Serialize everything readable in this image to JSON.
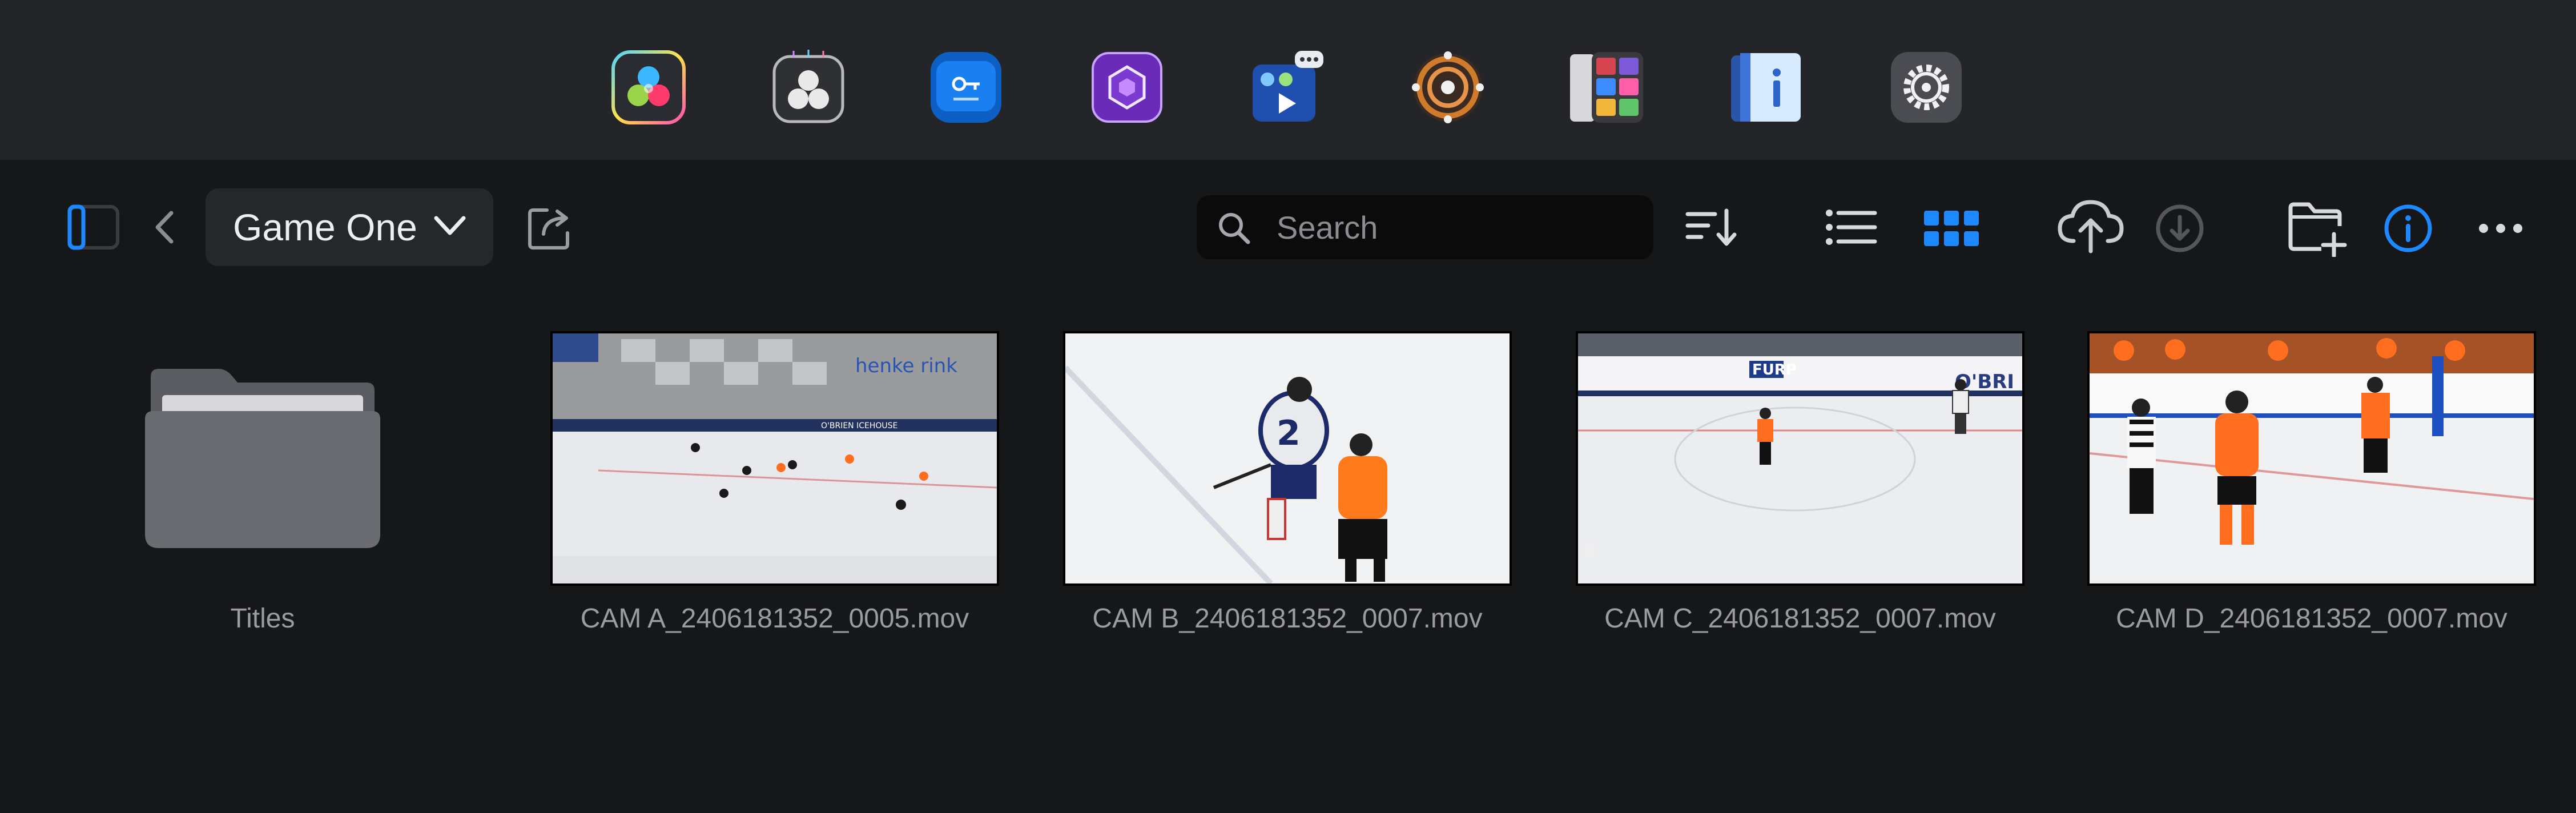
{
  "dock": {
    "apps": [
      {
        "name": "DaVinci Resolve",
        "icon": "davinci-resolve-icon"
      },
      {
        "name": "DaVinci Resolve Remote",
        "icon": "resolve-remote-icon"
      },
      {
        "name": "Blackmagic Key",
        "icon": "key-icon"
      },
      {
        "name": "Hex App",
        "icon": "hexagon-icon"
      },
      {
        "name": "Presentation Player",
        "icon": "presentation-icon"
      },
      {
        "name": "Remote Control",
        "icon": "dial-icon"
      },
      {
        "name": "Color Chart",
        "icon": "color-grid-icon"
      },
      {
        "name": "Info Book",
        "icon": "info-book-icon"
      },
      {
        "name": "Settings",
        "icon": "gear-icon"
      }
    ]
  },
  "toolbar": {
    "folder_name": "Game One",
    "search_placeholder": "Search",
    "accent": "#1e88ff"
  },
  "items": [
    {
      "label": "Titles",
      "type": "folder"
    },
    {
      "label": "CAM A_2406181352_0005.mov",
      "type": "video"
    },
    {
      "label": "CAM B_2406181352_0007.mov",
      "type": "video"
    },
    {
      "label": "CAM C_2406181352_0007.mov",
      "type": "video"
    },
    {
      "label": "CAM D_2406181352_0007.mov",
      "type": "video"
    }
  ],
  "thumb_texts": {
    "rink_sign": "henke rink",
    "board_ad": "O'BRIEN ICEHOUSE",
    "jersey_number": "2",
    "board_ad_c": "FURP",
    "board_ad_c2": "O'BRI"
  }
}
